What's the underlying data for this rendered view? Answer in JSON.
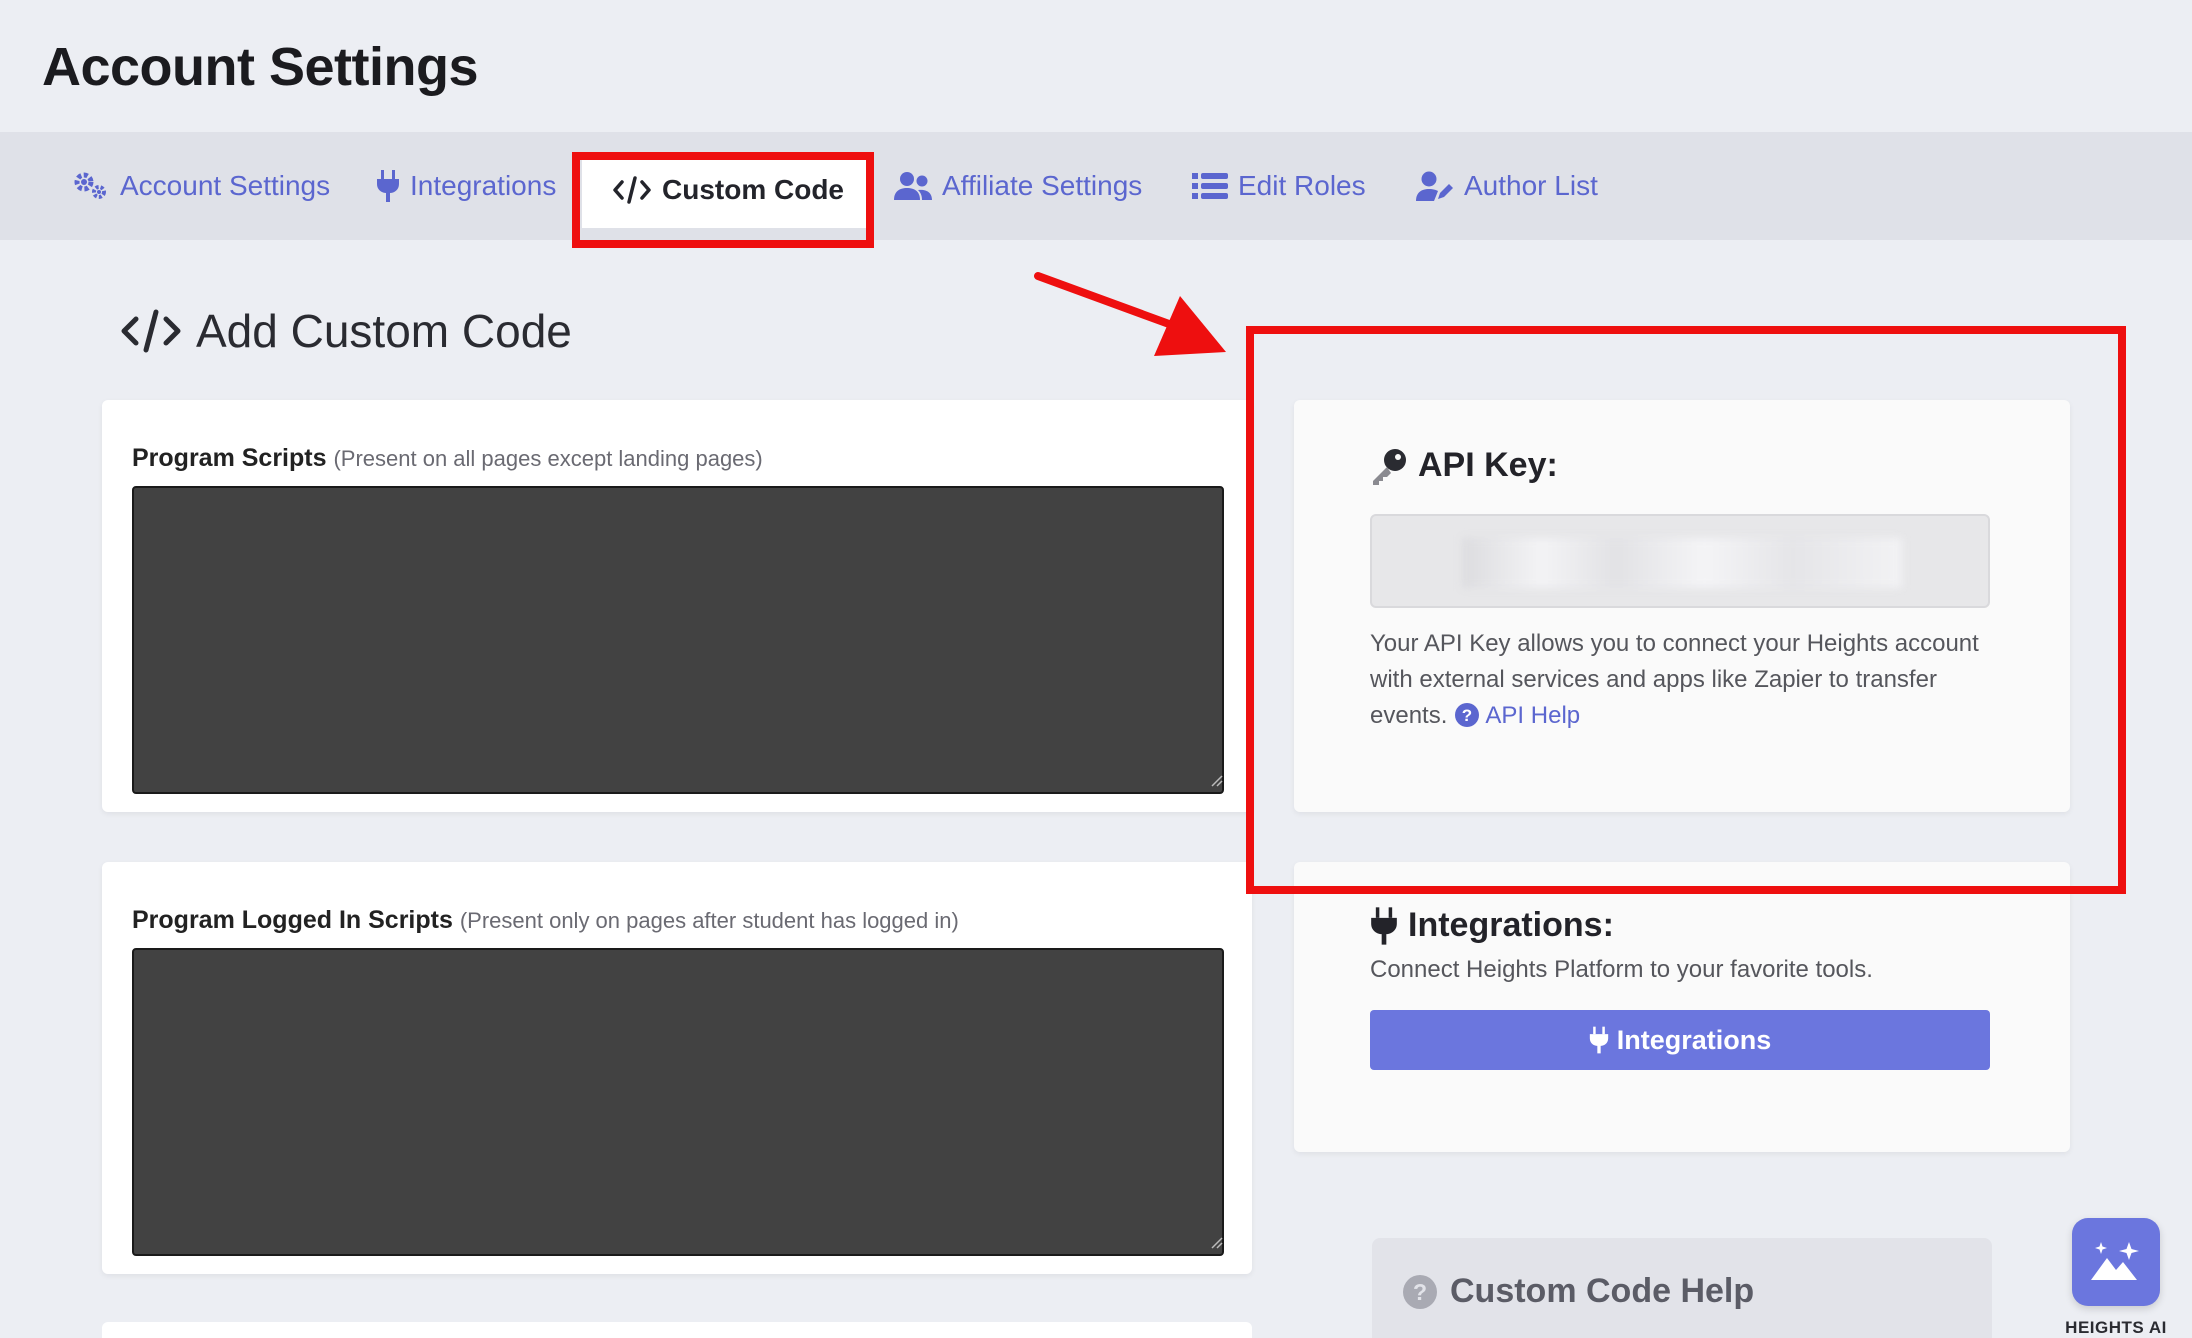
{
  "page": {
    "title": "Account Settings"
  },
  "tabs": [
    {
      "label": "Account Settings",
      "icon": "gears-icon"
    },
    {
      "label": "Integrations",
      "icon": "plug-icon"
    },
    {
      "label": "Custom Code",
      "icon": "code-icon",
      "active": true
    },
    {
      "label": "Affiliate Settings",
      "icon": "users-icon"
    },
    {
      "label": "Edit Roles",
      "icon": "list-icon"
    },
    {
      "label": "Author List",
      "icon": "user-edit-icon"
    }
  ],
  "section": {
    "title": "Add Custom Code",
    "icon": "code-icon"
  },
  "fields": {
    "program_scripts": {
      "label": "Program Scripts",
      "hint": "(Present on all pages except landing pages)",
      "value": ""
    },
    "logged_in_scripts": {
      "label": "Program Logged In Scripts",
      "hint": "(Present only on pages after student has logged in)",
      "value": ""
    }
  },
  "api_key": {
    "heading": "API Key:",
    "icon": "key-icon",
    "value": "",
    "description": "Your API Key allows you to connect your Heights account with external services and apps like Zapier to transfer events.",
    "help_link": "API Help",
    "help_icon": "question-circle-icon"
  },
  "integrations": {
    "heading": "Integrations:",
    "icon": "plug-icon",
    "subtitle": "Connect Heights Platform to your favorite tools.",
    "button_label": "Integrations"
  },
  "custom_code_help": {
    "heading": "Custom Code Help",
    "icon": "question-circle-icon"
  },
  "ai_assistant": {
    "label": "HEIGHTS AI",
    "icon": "sparkle-mountain-icon"
  },
  "colors": {
    "accent": "#6b76de",
    "link": "#5b66cf",
    "annotation": "#ee0f0f",
    "code_bg": "#424242"
  }
}
